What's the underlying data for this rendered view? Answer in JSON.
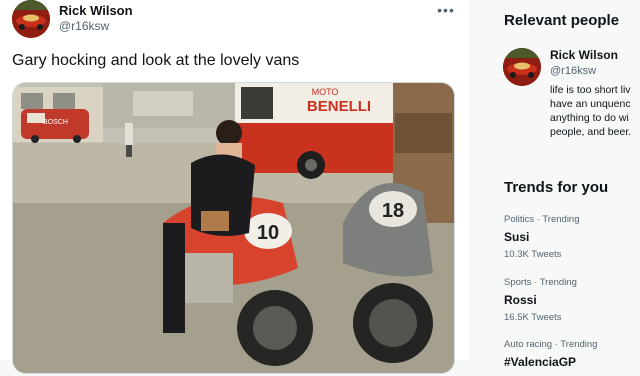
{
  "tweet": {
    "author_name": "Rick Wilson",
    "author_handle": "@r16ksw",
    "text": "Gary hocking and look at the lovely vans",
    "more_icon": "more-horizontal-icon",
    "photo": {
      "van_sign_line1": "MOTO",
      "van_sign_line2": "BENELLI",
      "small_van_label": "BOSCH",
      "bike_number_left": "10",
      "bike_number_right": "18"
    }
  },
  "relevant_people": {
    "heading": "Relevant people",
    "person": {
      "name": "Rick Wilson",
      "handle": "@r16ksw",
      "bio_lines": [
        "life is too short liv",
        "have an unquenc",
        "anything to do wi",
        "people, and beer."
      ]
    }
  },
  "trends": {
    "heading": "Trends for you",
    "items": [
      {
        "meta": "Politics · Trending",
        "name": "Susi",
        "count": "10.3K Tweets"
      },
      {
        "meta": "Sports · Trending",
        "name": "Rossi",
        "count": "16.5K Tweets"
      },
      {
        "meta": "Auto racing · Trending",
        "name": "#ValenciaGP",
        "count": ""
      }
    ]
  },
  "colors": {
    "text_primary": "#0f1419",
    "text_secondary": "#536471",
    "van_red": "#c8321f",
    "bike_red": "#d8432e"
  }
}
